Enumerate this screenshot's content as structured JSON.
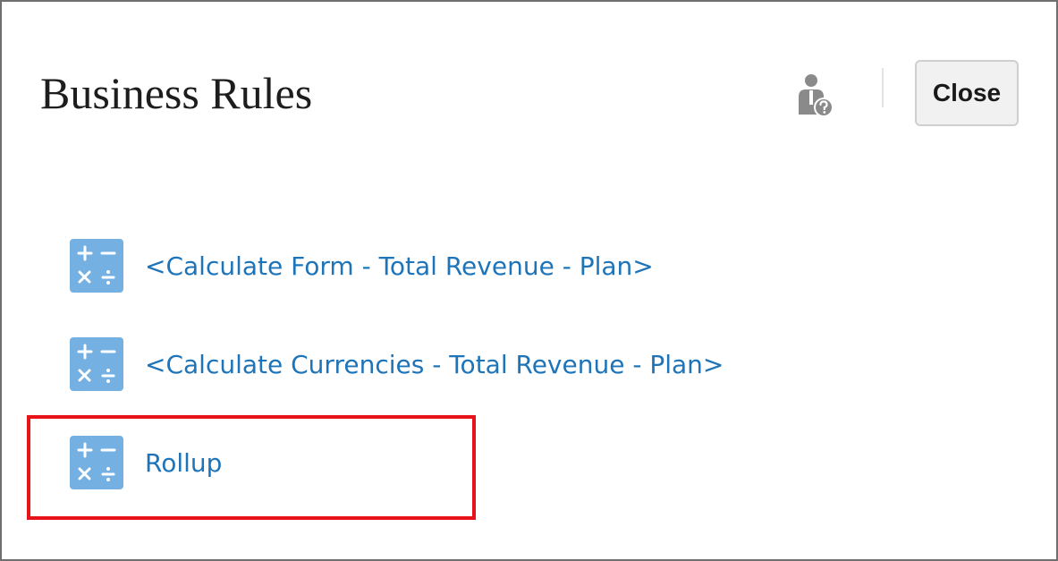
{
  "dialog": {
    "title": "Business Rules",
    "help_icon": "user-help-icon",
    "close_label": "Close"
  },
  "rules": [
    {
      "label": "<Calculate Form - Total Revenue - Plan>",
      "icon": "calculator-icon"
    },
    {
      "label": "<Calculate Currencies - Total Revenue - Plan>",
      "icon": "calculator-icon"
    },
    {
      "label": "Rollup",
      "icon": "calculator-icon",
      "highlighted": true
    }
  ],
  "colors": {
    "link": "#1e74b8",
    "icon_bg": "#75b0e3",
    "highlight": "#e8121a",
    "title": "#1d1d1d"
  }
}
